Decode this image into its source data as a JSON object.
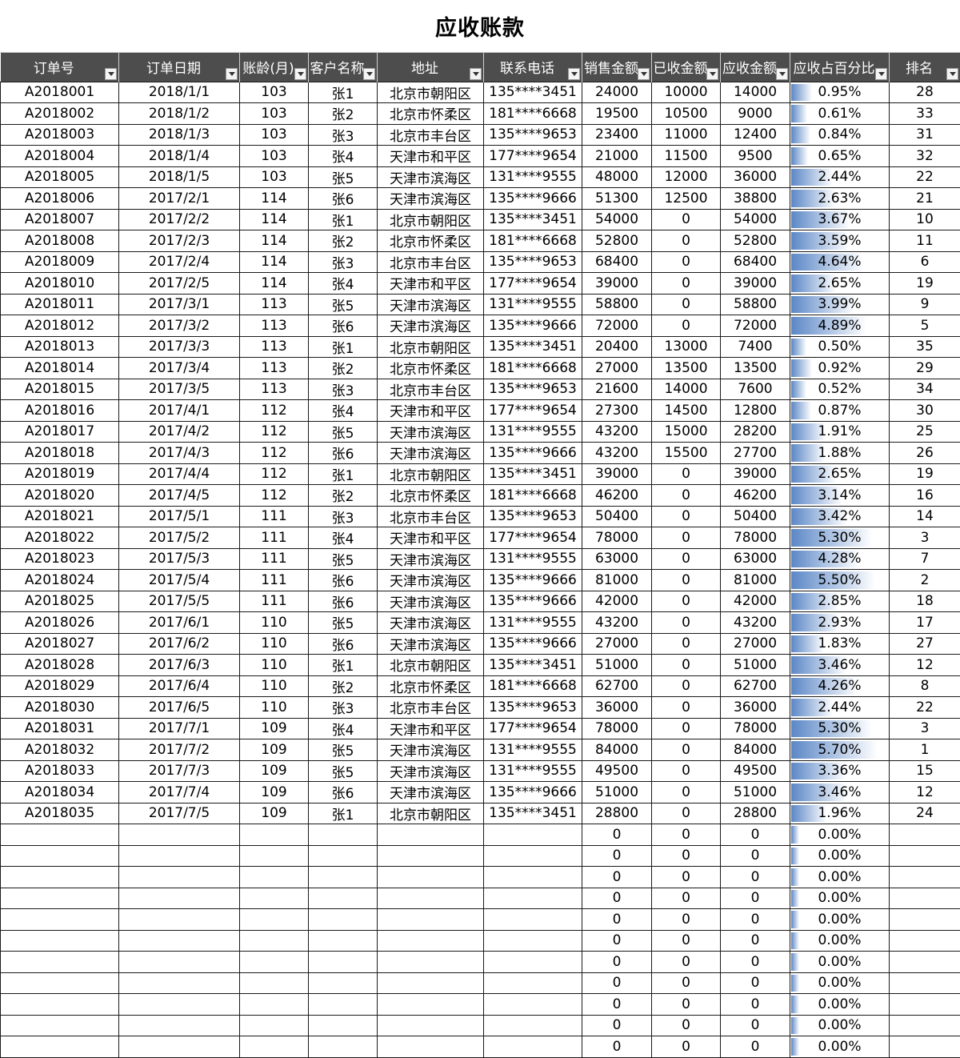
{
  "title": "应收账款",
  "headers": [
    "订单号",
    "订单日期",
    "账龄(月)",
    "客户名称",
    "地址",
    "联系电话",
    "销售金额",
    "已收金额",
    "应收金额",
    "应收占百分比",
    "排名"
  ],
  "rows": [
    [
      "A2018001",
      "2018/1/1",
      "103",
      "张1",
      "北京市朝阳区",
      "135****3451",
      "24000",
      "10000",
      "14000",
      "0.95%",
      "28"
    ],
    [
      "A2018002",
      "2018/1/2",
      "103",
      "张2",
      "北京市怀柔区",
      "181****6668",
      "19500",
      "10500",
      "9000",
      "0.61%",
      "33"
    ],
    [
      "A2018003",
      "2018/1/3",
      "103",
      "张3",
      "北京市丰台区",
      "135****9653",
      "23400",
      "11000",
      "12400",
      "0.84%",
      "31"
    ],
    [
      "A2018004",
      "2018/1/4",
      "103",
      "张4",
      "天津市和平区",
      "177****9654",
      "21000",
      "11500",
      "9500",
      "0.65%",
      "32"
    ],
    [
      "A2018005",
      "2018/1/5",
      "103",
      "张5",
      "天津市滨海区",
      "131****9555",
      "48000",
      "12000",
      "36000",
      "2.44%",
      "22"
    ],
    [
      "A2018006",
      "2017/2/1",
      "114",
      "张6",
      "天津市滨海区",
      "135****9666",
      "51300",
      "12500",
      "38800",
      "2.63%",
      "21"
    ],
    [
      "A2018007",
      "2017/2/2",
      "114",
      "张1",
      "北京市朝阳区",
      "135****3451",
      "54000",
      "0",
      "54000",
      "3.67%",
      "10"
    ],
    [
      "A2018008",
      "2017/2/3",
      "114",
      "张2",
      "北京市怀柔区",
      "181****6668",
      "52800",
      "0",
      "52800",
      "3.59%",
      "11"
    ],
    [
      "A2018009",
      "2017/2/4",
      "114",
      "张3",
      "北京市丰台区",
      "135****9653",
      "68400",
      "0",
      "68400",
      "4.64%",
      "6"
    ],
    [
      "A2018010",
      "2017/2/5",
      "114",
      "张4",
      "天津市和平区",
      "177****9654",
      "39000",
      "0",
      "39000",
      "2.65%",
      "19"
    ],
    [
      "A2018011",
      "2017/3/1",
      "113",
      "张5",
      "天津市滨海区",
      "131****9555",
      "58800",
      "0",
      "58800",
      "3.99%",
      "9"
    ],
    [
      "A2018012",
      "2017/3/2",
      "113",
      "张6",
      "天津市滨海区",
      "135****9666",
      "72000",
      "0",
      "72000",
      "4.89%",
      "5"
    ],
    [
      "A2018013",
      "2017/3/3",
      "113",
      "张1",
      "北京市朝阳区",
      "135****3451",
      "20400",
      "13000",
      "7400",
      "0.50%",
      "35"
    ],
    [
      "A2018014",
      "2017/3/4",
      "113",
      "张2",
      "北京市怀柔区",
      "181****6668",
      "27000",
      "13500",
      "13500",
      "0.92%",
      "29"
    ],
    [
      "A2018015",
      "2017/3/5",
      "113",
      "张3",
      "北京市丰台区",
      "135****9653",
      "21600",
      "14000",
      "7600",
      "0.52%",
      "34"
    ],
    [
      "A2018016",
      "2017/4/1",
      "112",
      "张4",
      "天津市和平区",
      "177****9654",
      "27300",
      "14500",
      "12800",
      "0.87%",
      "30"
    ],
    [
      "A2018017",
      "2017/4/2",
      "112",
      "张5",
      "天津市滨海区",
      "131****9555",
      "43200",
      "15000",
      "28200",
      "1.91%",
      "25"
    ],
    [
      "A2018018",
      "2017/4/3",
      "112",
      "张6",
      "天津市滨海区",
      "135****9666",
      "43200",
      "15500",
      "27700",
      "1.88%",
      "26"
    ],
    [
      "A2018019",
      "2017/4/4",
      "112",
      "张1",
      "北京市朝阳区",
      "135****3451",
      "39000",
      "0",
      "39000",
      "2.65%",
      "19"
    ],
    [
      "A2018020",
      "2017/4/5",
      "112",
      "张2",
      "北京市怀柔区",
      "181****6668",
      "46200",
      "0",
      "46200",
      "3.14%",
      "16"
    ],
    [
      "A2018021",
      "2017/5/1",
      "111",
      "张3",
      "北京市丰台区",
      "135****9653",
      "50400",
      "0",
      "50400",
      "3.42%",
      "14"
    ],
    [
      "A2018022",
      "2017/5/2",
      "111",
      "张4",
      "天津市和平区",
      "177****9654",
      "78000",
      "0",
      "78000",
      "5.30%",
      "3"
    ],
    [
      "A2018023",
      "2017/5/3",
      "111",
      "张5",
      "天津市滨海区",
      "131****9555",
      "63000",
      "0",
      "63000",
      "4.28%",
      "7"
    ],
    [
      "A2018024",
      "2017/5/4",
      "111",
      "张6",
      "天津市滨海区",
      "135****9666",
      "81000",
      "0",
      "81000",
      "5.50%",
      "2"
    ],
    [
      "A2018025",
      "2017/5/5",
      "111",
      "张6",
      "天津市滨海区",
      "135****9666",
      "42000",
      "0",
      "42000",
      "2.85%",
      "18"
    ],
    [
      "A2018026",
      "2017/6/1",
      "110",
      "张5",
      "天津市滨海区",
      "131****9555",
      "43200",
      "0",
      "43200",
      "2.93%",
      "17"
    ],
    [
      "A2018027",
      "2017/6/2",
      "110",
      "张6",
      "天津市滨海区",
      "135****9666",
      "27000",
      "0",
      "27000",
      "1.83%",
      "27"
    ],
    [
      "A2018028",
      "2017/6/3",
      "110",
      "张1",
      "北京市朝阳区",
      "135****3451",
      "51000",
      "0",
      "51000",
      "3.46%",
      "12"
    ],
    [
      "A2018029",
      "2017/6/4",
      "110",
      "张2",
      "北京市怀柔区",
      "181****6668",
      "62700",
      "0",
      "62700",
      "4.26%",
      "8"
    ],
    [
      "A2018030",
      "2017/6/5",
      "110",
      "张3",
      "北京市丰台区",
      "135****9653",
      "36000",
      "0",
      "36000",
      "2.44%",
      "22"
    ],
    [
      "A2018031",
      "2017/7/1",
      "109",
      "张4",
      "天津市和平区",
      "177****9654",
      "78000",
      "0",
      "78000",
      "5.30%",
      "3"
    ],
    [
      "A2018032",
      "2017/7/2",
      "109",
      "张5",
      "天津市滨海区",
      "131****9555",
      "84000",
      "0",
      "84000",
      "5.70%",
      "1"
    ],
    [
      "A2018033",
      "2017/7/3",
      "109",
      "张5",
      "天津市滨海区",
      "131****9555",
      "49500",
      "0",
      "49500",
      "3.36%",
      "15"
    ],
    [
      "A2018034",
      "2017/7/4",
      "109",
      "张6",
      "天津市滨海区",
      "135****9666",
      "51000",
      "0",
      "51000",
      "3.46%",
      "12"
    ],
    [
      "A2018035",
      "2017/7/5",
      "109",
      "张1",
      "北京市朝阳区",
      "135****3451",
      "28800",
      "0",
      "28800",
      "1.96%",
      "24"
    ],
    [
      "",
      "",
      "",
      "",
      "",
      "",
      "0",
      "0",
      "0",
      "0.00%",
      ""
    ],
    [
      "",
      "",
      "",
      "",
      "",
      "",
      "0",
      "0",
      "0",
      "0.00%",
      ""
    ],
    [
      "",
      "",
      "",
      "",
      "",
      "",
      "0",
      "0",
      "0",
      "0.00%",
      ""
    ],
    [
      "",
      "",
      "",
      "",
      "",
      "",
      "0",
      "0",
      "0",
      "0.00%",
      ""
    ],
    [
      "",
      "",
      "",
      "",
      "",
      "",
      "0",
      "0",
      "0",
      "0.00%",
      ""
    ],
    [
      "",
      "",
      "",
      "",
      "",
      "",
      "0",
      "0",
      "0",
      "0.00%",
      ""
    ],
    [
      "",
      "",
      "",
      "",
      "",
      "",
      "0",
      "0",
      "0",
      "0.00%",
      ""
    ],
    [
      "",
      "",
      "",
      "",
      "",
      "",
      "0",
      "0",
      "0",
      "0.00%",
      ""
    ],
    [
      "",
      "",
      "",
      "",
      "",
      "",
      "0",
      "0",
      "0",
      "0.00%",
      ""
    ],
    [
      "",
      "",
      "",
      "",
      "",
      "",
      "0",
      "0",
      "0",
      "0.00%",
      ""
    ],
    [
      "",
      "",
      "",
      "",
      "",
      "",
      "0",
      "0",
      "0",
      "0.00%",
      ""
    ]
  ]
}
